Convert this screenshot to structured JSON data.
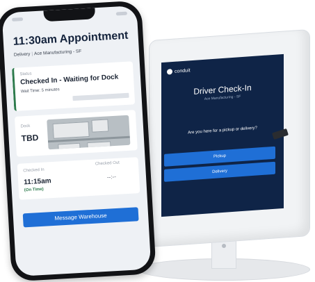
{
  "phone": {
    "title": "11:30am Appointment",
    "subtitle_type": "Delivery",
    "subtitle_sep": "|",
    "subtitle_location": "Ace Manufacturing - SF",
    "status": {
      "label": "Status",
      "value": "Checked In - Waiting for Dock",
      "wait": "Wait Time: 5 minutes"
    },
    "dock": {
      "label": "Dock",
      "value": "TBD"
    },
    "checked_in": {
      "label": "Checked In",
      "time": "11:15am",
      "note": "(On Time)"
    },
    "checked_out": {
      "label": "Checked Out",
      "time": "--:--"
    },
    "button": "Message Warehouse"
  },
  "kiosk": {
    "brand": "conduit",
    "title": "Driver Check-In",
    "location": "Ace Manufacturing - SF",
    "question": "Are you here for a pickup or delivery?",
    "options": [
      "Pickup",
      "Delivery"
    ]
  },
  "colors": {
    "accent": "#1f6fd6",
    "kiosk_screen": "#0f2447",
    "status_green": "#2c7a4b"
  }
}
